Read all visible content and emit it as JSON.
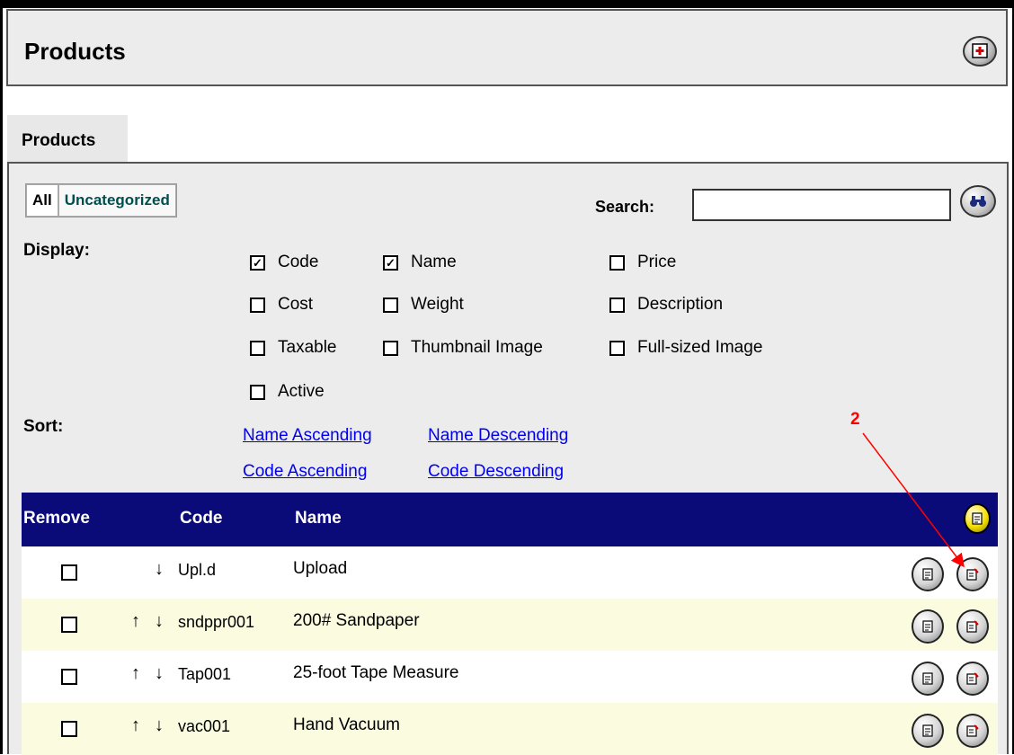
{
  "window": {
    "title": "Products"
  },
  "tab": {
    "label": "Products"
  },
  "filters": {
    "all": "All",
    "uncategorized": "Uncategorized"
  },
  "search": {
    "label": "Search:",
    "value": "",
    "placeholder": ""
  },
  "display": {
    "label": "Display:",
    "options": [
      {
        "label": "Code",
        "checked": true
      },
      {
        "label": "Name",
        "checked": true
      },
      {
        "label": "Price",
        "checked": false
      },
      {
        "label": "Cost",
        "checked": false
      },
      {
        "label": "Weight",
        "checked": false
      },
      {
        "label": "Description",
        "checked": false
      },
      {
        "label": "Taxable",
        "checked": false
      },
      {
        "label": "Thumbnail Image",
        "checked": false
      },
      {
        "label": "Full-sized Image",
        "checked": false
      },
      {
        "label": "Active",
        "checked": false
      }
    ]
  },
  "sort": {
    "label": "Sort:",
    "links": [
      "Name Ascending",
      "Name Descending",
      "Code Ascending",
      "Code Descending"
    ]
  },
  "table": {
    "headers": {
      "remove": "Remove",
      "code": "Code",
      "name": "Name"
    },
    "rows": [
      {
        "code": "Upl.d",
        "name": "Upload",
        "up": false,
        "down": true
      },
      {
        "code": "sndppr001",
        "name": "200# Sandpaper",
        "up": true,
        "down": true
      },
      {
        "code": "Tap001",
        "name": "25-foot Tape Measure",
        "up": true,
        "down": true
      },
      {
        "code": "vac001",
        "name": "Hand Vacuum",
        "up": true,
        "down": true
      }
    ]
  },
  "annotation": {
    "number": "2",
    "color": "#ff0000"
  },
  "colors": {
    "header_bg": "#0a0a78",
    "row_alt_bg": "#fbfbe0",
    "link": "#0000ee"
  },
  "icons": {
    "window": "close-window-icon",
    "search": "binoculars-icon",
    "add": "add-document-icon",
    "view": "document-icon",
    "edit": "edit-document-icon"
  }
}
